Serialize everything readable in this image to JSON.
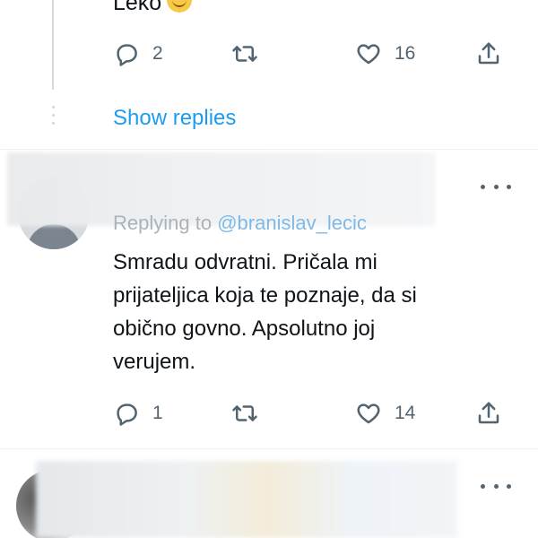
{
  "tweet_prev": {
    "text_visible": "Leko",
    "emoji_icon": "smiling-face-icon",
    "reply_count": "2",
    "like_count": "16",
    "show_replies_label": "Show replies"
  },
  "tweet_main": {
    "replying_prefix": "Replying to",
    "replying_handle": "@branislav_lecic",
    "text_lines": [
      "Smradu odvratni. Pričala mi",
      "prijateljica koja te poznaje, da si",
      "obično govno. Apsolutno joj",
      "verujem."
    ],
    "reply_count": "1",
    "like_count": "14"
  },
  "colors": {
    "accent": "#1d9bf0",
    "icon": "#536471",
    "text": "#0f1419",
    "divider": "#eff3f4"
  }
}
